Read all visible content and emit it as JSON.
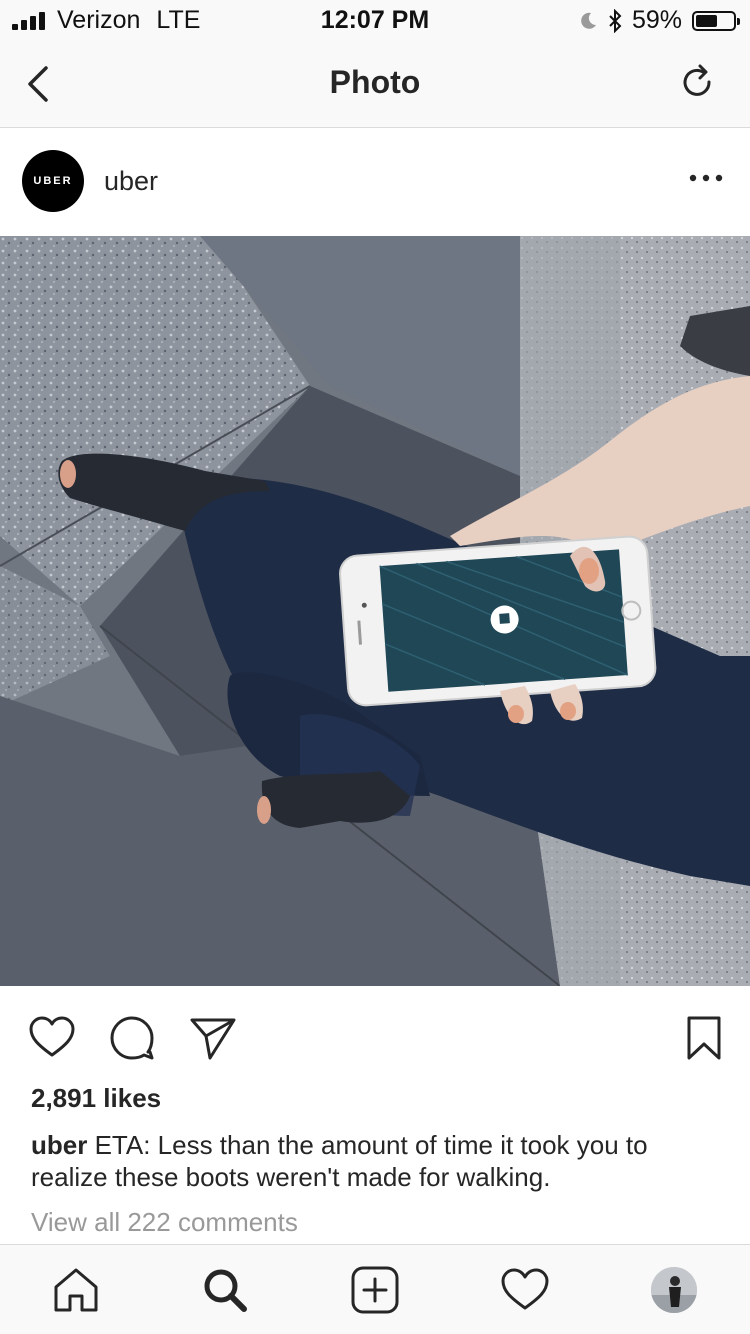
{
  "status_bar": {
    "carrier": "Verizon",
    "network": "LTE",
    "time": "12:07 PM",
    "battery": "59%",
    "battery_level": 0.59
  },
  "nav": {
    "title": "Photo"
  },
  "post": {
    "avatar_text": "UBER",
    "username": "uber",
    "likes": "2,891 likes",
    "caption_user": "uber",
    "caption_text": "ETA: Less than the amount of time it took you to realize these boots weren't made for walking.",
    "comments_link": "View all 222 comments"
  },
  "icons": {
    "back": "chevron-left-icon",
    "refresh": "refresh-icon",
    "more": "more-horizontal-icon",
    "like": "heart-icon",
    "comment": "comment-icon",
    "share": "paper-plane-icon",
    "save": "bookmark-icon",
    "home": "home-icon",
    "search": "search-icon",
    "add": "plus-square-icon",
    "activity": "heart-icon",
    "profile": "avatar"
  }
}
